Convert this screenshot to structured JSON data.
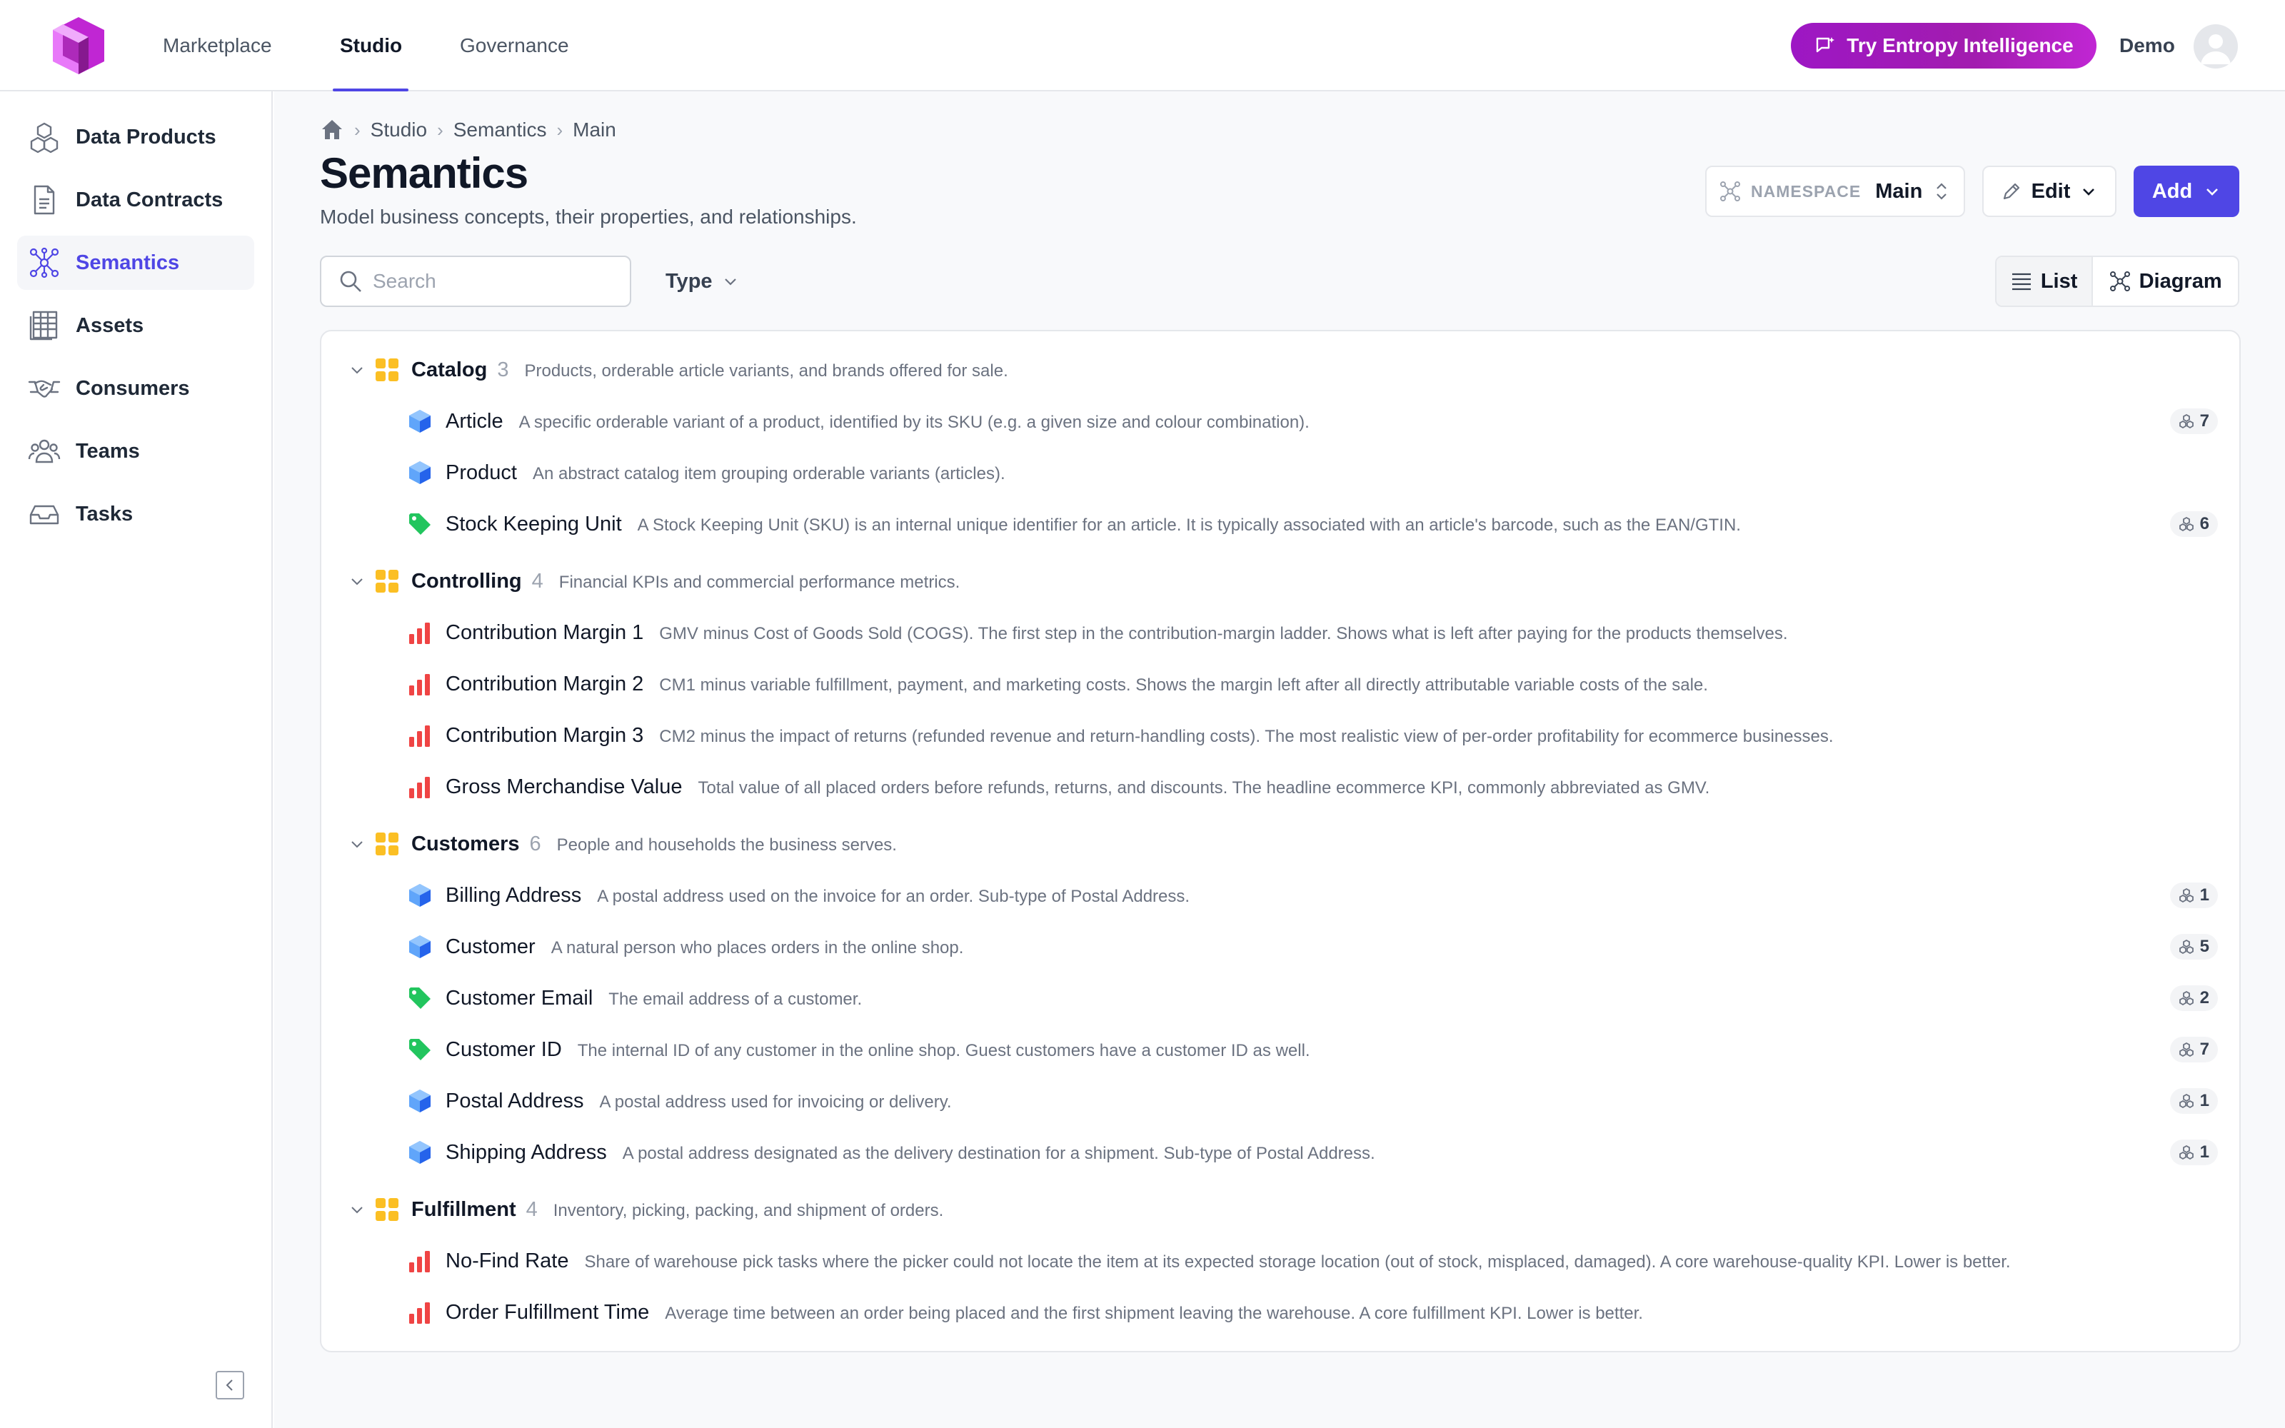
{
  "topbar": {
    "nav": [
      {
        "label": "Marketplace",
        "active": false
      },
      {
        "label": "Studio",
        "active": true
      },
      {
        "label": "Governance",
        "active": false
      }
    ],
    "try_button": "Try Entropy Intelligence",
    "user": "Demo"
  },
  "sidebar": {
    "items": [
      {
        "label": "Data Products",
        "icon": "cubes-icon"
      },
      {
        "label": "Data Contracts",
        "icon": "document-icon"
      },
      {
        "label": "Semantics",
        "icon": "graph-icon",
        "active": true
      },
      {
        "label": "Assets",
        "icon": "table-icon"
      },
      {
        "label": "Consumers",
        "icon": "handshake-icon"
      },
      {
        "label": "Teams",
        "icon": "people-icon"
      },
      {
        "label": "Tasks",
        "icon": "inbox-icon"
      }
    ]
  },
  "breadcrumb": [
    "Studio",
    "Semantics",
    "Main"
  ],
  "page": {
    "title": "Semantics",
    "subtitle": "Model business concepts, their properties, and relationships."
  },
  "toolbar": {
    "namespace_label": "NAMESPACE",
    "namespace_value": "Main",
    "edit_label": "Edit",
    "add_label": "Add",
    "search_placeholder": "Search",
    "type_label": "Type",
    "list_label": "List",
    "diagram_label": "Diagram"
  },
  "colors": {
    "accent": "#4f46e5",
    "group_icon": "#fbbf24",
    "entity_icon": "#3b82f6",
    "property_icon": "#22c55e",
    "metric_icon": "#ef4444"
  },
  "groups": [
    {
      "name": "Catalog",
      "count": "3",
      "description": "Products, orderable article variants, and brands offered for sale.",
      "items": [
        {
          "name": "Article",
          "kind": "entity",
          "description": "A specific orderable variant of a product, identified by its SKU (e.g. a given size and colour combination).",
          "badge": "7"
        },
        {
          "name": "Product",
          "kind": "entity",
          "description": "An abstract catalog item grouping orderable variants (articles).",
          "badge": null
        },
        {
          "name": "Stock Keeping Unit",
          "kind": "property",
          "description": "A Stock Keeping Unit (SKU) is an internal unique identifier for an article. It is typically associated with an article's barcode, such as the EAN/GTIN.",
          "badge": "6"
        }
      ]
    },
    {
      "name": "Controlling",
      "count": "4",
      "description": "Financial KPIs and commercial performance metrics.",
      "items": [
        {
          "name": "Contribution Margin 1",
          "kind": "metric",
          "description": "GMV minus Cost of Goods Sold (COGS). The first step in the contribution-margin ladder. Shows what is left after paying for the products themselves.",
          "badge": null
        },
        {
          "name": "Contribution Margin 2",
          "kind": "metric",
          "description": "CM1 minus variable fulfillment, payment, and marketing costs. Shows the margin left after all directly attributable variable costs of the sale.",
          "badge": null
        },
        {
          "name": "Contribution Margin 3",
          "kind": "metric",
          "description": "CM2 minus the impact of returns (refunded revenue and return-handling costs). The most realistic view of per-order profitability for ecommerce businesses.",
          "badge": null
        },
        {
          "name": "Gross Merchandise Value",
          "kind": "metric",
          "description": "Total value of all placed orders before refunds, returns, and discounts. The headline ecommerce KPI, commonly abbreviated as GMV.",
          "badge": null
        }
      ]
    },
    {
      "name": "Customers",
      "count": "6",
      "description": "People and households the business serves.",
      "items": [
        {
          "name": "Billing Address",
          "kind": "entity",
          "description": "A postal address used on the invoice for an order. Sub-type of Postal Address.",
          "badge": "1"
        },
        {
          "name": "Customer",
          "kind": "entity",
          "description": "A natural person who places orders in the online shop.",
          "badge": "5"
        },
        {
          "name": "Customer Email",
          "kind": "property",
          "description": "The email address of a customer.",
          "badge": "2"
        },
        {
          "name": "Customer ID",
          "kind": "property",
          "description": "The internal ID of any customer in the online shop. Guest customers have a customer ID as well.",
          "badge": "7"
        },
        {
          "name": "Postal Address",
          "kind": "entity",
          "description": "A postal address used for invoicing or delivery.",
          "badge": "1"
        },
        {
          "name": "Shipping Address",
          "kind": "entity",
          "description": "A postal address designated as the delivery destination for a shipment. Sub-type of Postal Address.",
          "badge": "1"
        }
      ]
    },
    {
      "name": "Fulfillment",
      "count": "4",
      "description": "Inventory, picking, packing, and shipment of orders.",
      "items": [
        {
          "name": "No-Find Rate",
          "kind": "metric",
          "description": "Share of warehouse pick tasks where the picker could not locate the item at its expected storage location (out of stock, misplaced, damaged). A core warehouse-quality KPI. Lower is better.",
          "badge": null
        },
        {
          "name": "Order Fulfillment Time",
          "kind": "metric",
          "description": "Average time between an order being placed and the first shipment leaving the warehouse. A core fulfillment KPI. Lower is better.",
          "badge": null
        }
      ]
    }
  ]
}
